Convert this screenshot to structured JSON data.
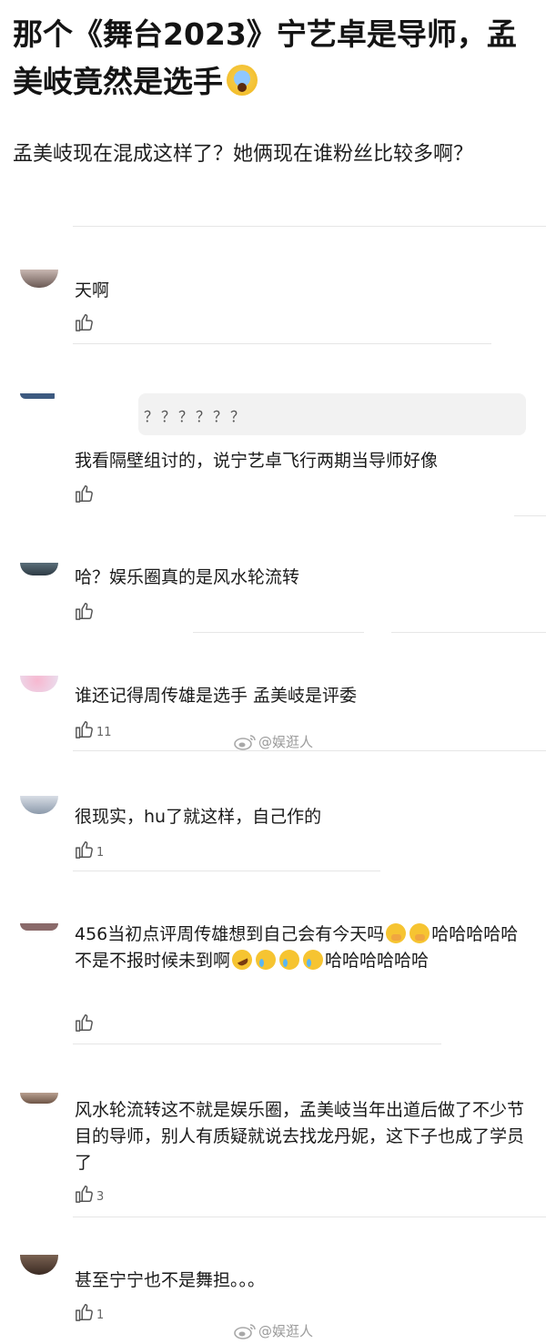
{
  "post": {
    "title": "那个《舞台2023》宁艺卓是导师，孟美岐竟然是选手",
    "title_emoji": "scream-face",
    "body": "孟美岐现在混成这样了？她俩现在谁粉丝比较多啊？"
  },
  "comments": [
    {
      "text": "天啊",
      "likes": ""
    },
    {
      "reply_quote": "？？？？？？",
      "text": "我看隔壁组讨的，说宁艺卓飞行两期当导师好像",
      "likes": ""
    },
    {
      "text": "哈？娱乐圈真的是风水轮流转",
      "likes": ""
    },
    {
      "text": "谁还记得周传雄是选手 孟美岐是评委",
      "likes": "11"
    },
    {
      "text": "很现实，hu了就这样，自己作的",
      "likes": "1"
    },
    {
      "text_a": "456当初点评周传雄想到自己会有今天吗",
      "text_b": "哈哈哈哈哈不是不报时候未到啊",
      "text_c": "哈哈哈哈哈哈",
      "likes": ""
    },
    {
      "text": "风水轮流转这不就是娱乐圈，孟美岐当年出道后做了不少节目的导师，别人有质疑就说去找龙丹妮，这下子也成了学员了",
      "likes": "3"
    },
    {
      "text": "甚至宁宁也不是舞担。。。",
      "likes": "1"
    }
  ],
  "watermark": {
    "text": "@娱逛人"
  },
  "icons": {
    "like": "thumbs-up-icon",
    "weibo": "weibo-logo"
  }
}
